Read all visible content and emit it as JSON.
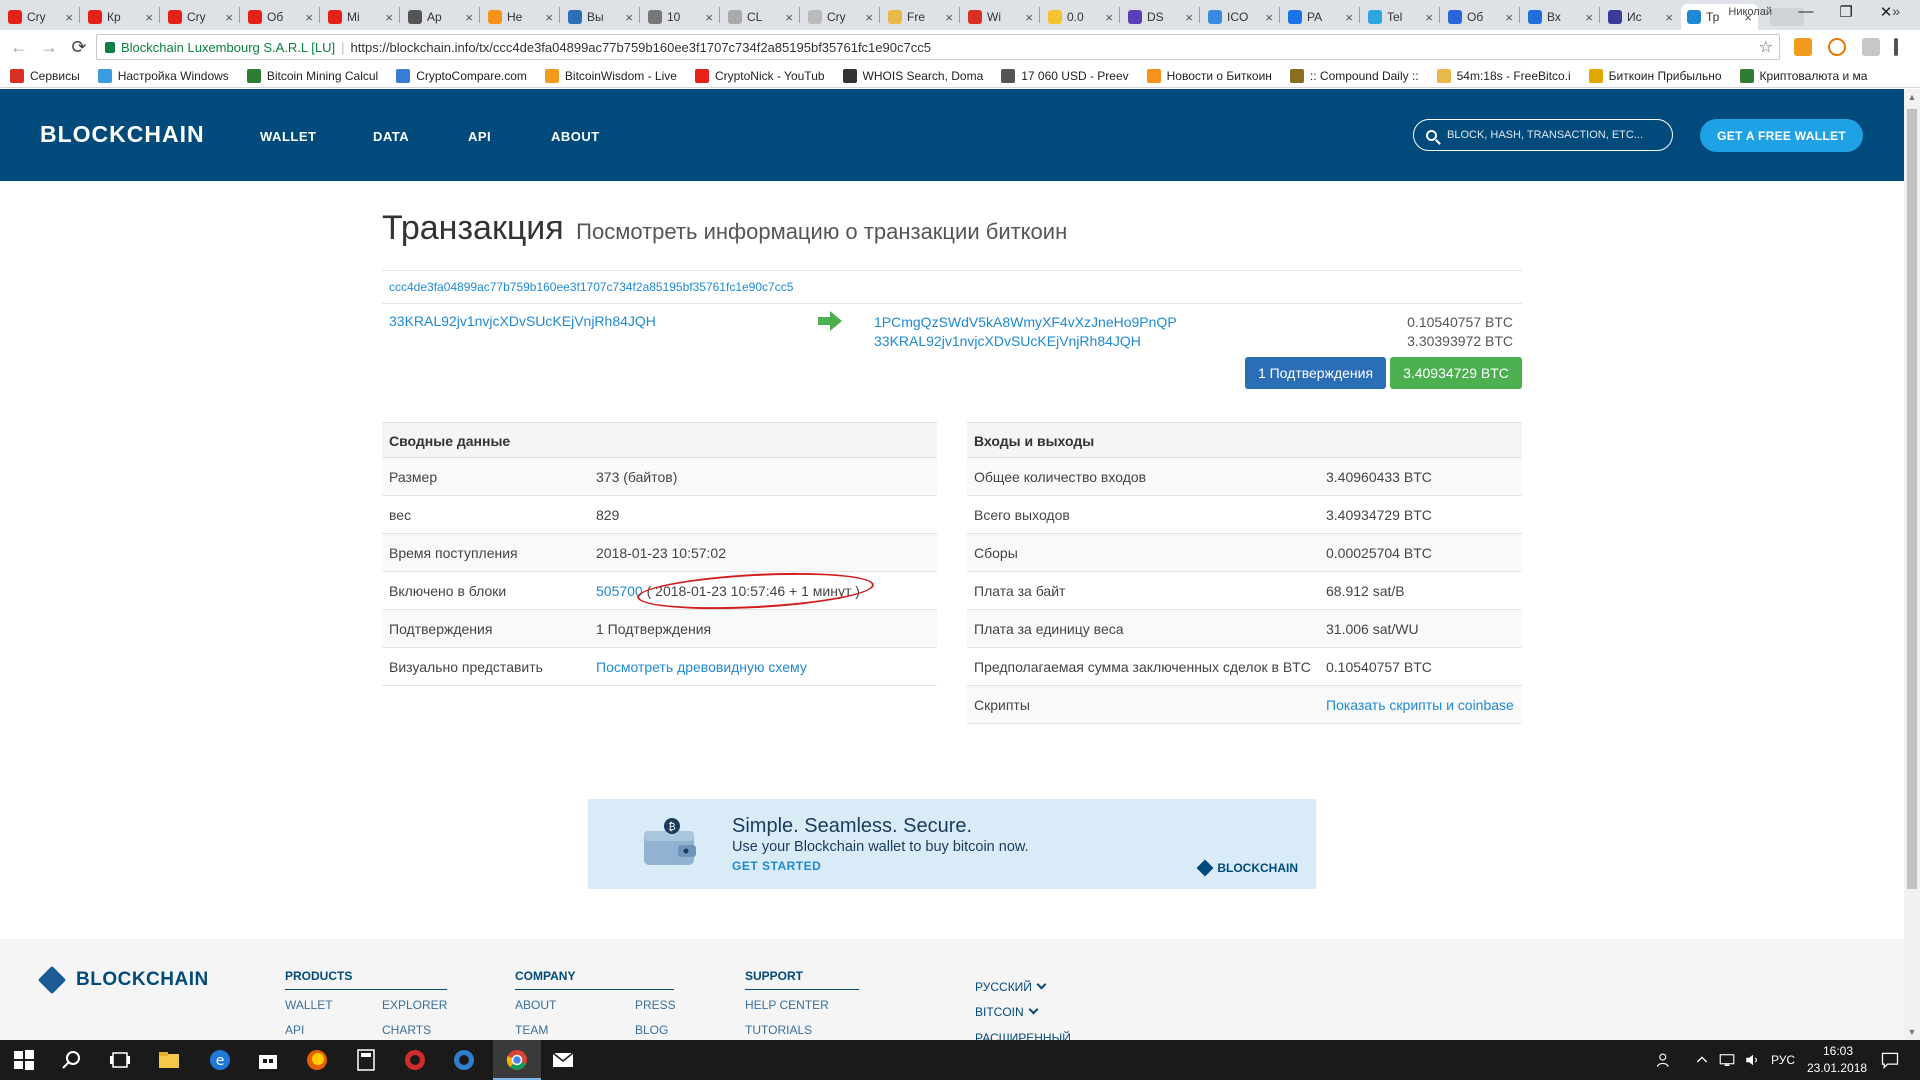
{
  "browser": {
    "tabs": [
      {
        "label": "Cry",
        "color": "#e62117"
      },
      {
        "label": "Кр",
        "color": "#e62117"
      },
      {
        "label": "Cry",
        "color": "#e62117"
      },
      {
        "label": "Об",
        "color": "#e62117"
      },
      {
        "label": "Mi",
        "color": "#e62117"
      },
      {
        "label": "Ap",
        "color": "#555555"
      },
      {
        "label": "Не",
        "color": "#f7931a"
      },
      {
        "label": "Вы",
        "color": "#2c6fb5"
      },
      {
        "label": "10",
        "color": "#777777"
      },
      {
        "label": "CL",
        "color": "#aaaaaa"
      },
      {
        "label": "Cry",
        "color": "#bbbbbb"
      },
      {
        "label": "Fre",
        "color": "#e9b949"
      },
      {
        "label": "Wi",
        "color": "#d93025"
      },
      {
        "label": "0.0",
        "color": "#f4c430"
      },
      {
        "label": "DS",
        "color": "#5a3fb8"
      },
      {
        "label": "ICO",
        "color": "#3a8be0"
      },
      {
        "label": "PA",
        "color": "#1a73e8"
      },
      {
        "label": "Tel",
        "color": "#2ca5e0"
      },
      {
        "label": "Об",
        "color": "#2a66d9"
      },
      {
        "label": "Вх",
        "color": "#1e6fd9"
      },
      {
        "label": "Ис",
        "color": "#3b3b9a"
      },
      {
        "label": "Тр",
        "color": "#1e8ad6",
        "active": true
      }
    ],
    "tab_close": "×",
    "user_name": "Николай",
    "window": {
      "minimize": "—",
      "maximize": "❐",
      "close": "✕"
    },
    "nav": {
      "back": "←",
      "forward": "→",
      "reload": "⟳"
    },
    "address": {
      "secure_label": "Blockchain Luxembourg S.A.R.L [LU]",
      "separator": "|",
      "url": "https://blockchain.info/tx/ccc4de3fa04899ac77b759b160ee3f1707c734f2a85195bf35761fc1e90c7cc5"
    },
    "star": "☆",
    "bookmarks": [
      {
        "label": "Сервисы",
        "color": "#d93025"
      },
      {
        "label": "Настройка Windows",
        "color": "#3a9be0"
      },
      {
        "label": "Bitcoin Mining Calcul",
        "color": "#2e7d32"
      },
      {
        "label": "CryptoCompare.com",
        "color": "#3a7bd5"
      },
      {
        "label": "BitcoinWisdom - Live",
        "color": "#f29b1d"
      },
      {
        "label": "CryptoNick - YouTub",
        "color": "#e62117"
      },
      {
        "label": "WHOIS Search, Doma",
        "color": "#333333"
      },
      {
        "label": "17 060 USD - Preev",
        "color": "#555555"
      },
      {
        "label": "Новости о Биткоин",
        "color": "#f7931a"
      },
      {
        "label": ":: Compound Daily ::",
        "color": "#8a6d1e"
      },
      {
        "label": "54m:18s - FreeBitco.i",
        "color": "#e9b949"
      },
      {
        "label": "Биткоин Прибыльно",
        "color": "#e0a800"
      },
      {
        "label": "Криптовалюта и ма",
        "color": "#2e7d32"
      }
    ],
    "bookmarks_more": "»"
  },
  "site": {
    "brand": "BLOCKCHAIN",
    "nav": [
      "WALLET",
      "DATA",
      "API",
      "ABOUT"
    ],
    "search_placeholder": "BLOCK, HASH, TRANSACTION, ETC...",
    "cta": "GET A FREE WALLET"
  },
  "transaction": {
    "title": "Транзакция",
    "subtitle": "Посмотреть информацию о транзакции биткоин",
    "hash": "ccc4de3fa04899ac77b759b160ee3f1707c734f2a85195bf35761fc1e90c7cc5",
    "from": "33KRAL92jv1nvjcXDvSUcKEjVnjRh84JQH",
    "outputs": [
      {
        "address": "1PCmgQzSWdV5kA8WmyXF4vXzJneHo9PnQP",
        "amount": "0.10540757 BTC"
      },
      {
        "address": "33KRAL92jv1nvjcXDvSUcKEjVnjRh84JQH",
        "amount": "3.30393972 BTC"
      }
    ],
    "confirmations_badge": "1 Подтверждения",
    "total_badge": "3.40934729 BTC"
  },
  "summary": {
    "header": "Сводные данные",
    "rows": [
      {
        "label": "Размер",
        "value": "373 (байтов)"
      },
      {
        "label": "вес",
        "value": "829"
      },
      {
        "label": "Время поступления",
        "value": "2018-01-23 10:57:02"
      },
      {
        "label": "Включено в блоки",
        "block": "505700",
        "value": "( 2018-01-23 10:57:46 + 1 минут )"
      },
      {
        "label": "Подтверждения",
        "value": "1 Подтверждения"
      },
      {
        "label": "Визуально представить",
        "link": "Посмотреть древовидную схему"
      }
    ]
  },
  "io": {
    "header": "Входы и выходы",
    "rows": [
      {
        "label": "Общее количество входов",
        "value": "3.40960433 BTC"
      },
      {
        "label": "Всего выходов",
        "value": "3.40934729 BTC"
      },
      {
        "label": "Сборы",
        "value": "0.00025704 BTC"
      },
      {
        "label": "Плата за байт",
        "value": "68.912 sat/B"
      },
      {
        "label": "Плата за единицу веса",
        "value": "31.006 sat/WU"
      },
      {
        "label": "Предполагаемая сумма заключенных сделок в BTC",
        "value": "0.10540757 BTC"
      },
      {
        "label": "Скрипты",
        "link": "Показать скрипты и coinbase"
      }
    ]
  },
  "banner": {
    "headline": "Simple. Seamless. Secure.",
    "text": "Use your Blockchain wallet to buy bitcoin now.",
    "cta": "GET STARTED",
    "brand": "BLOCKCHAIN"
  },
  "footer": {
    "brand": "BLOCKCHAIN",
    "products": {
      "title": "PRODUCTS",
      "links": [
        "WALLET",
        "EXPLORER",
        "API",
        "CHARTS"
      ]
    },
    "company": {
      "title": "COMPANY",
      "links": [
        "ABOUT",
        "PRESS",
        "TEAM",
        "BLOG"
      ]
    },
    "support": {
      "title": "SUPPORT",
      "links": [
        "HELP CENTER",
        "TUTORIALS"
      ]
    },
    "language": "РУССКИЙ",
    "currency": "BITCOIN",
    "advanced": "РАСШИРЕННЫЙ"
  },
  "taskbar": {
    "lang": "РУС",
    "time": "16:03",
    "date": "23.01.2018"
  }
}
